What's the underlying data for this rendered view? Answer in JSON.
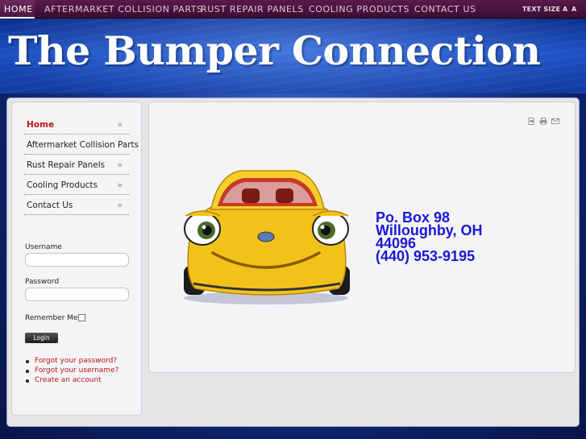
{
  "topnav": {
    "items": [
      "HOME",
      "AFTERMARKET COLLISION PARTS",
      "RUST REPAIR PANELS",
      "COOLING PRODUCTS",
      "CONTACT US"
    ],
    "active": "HOME",
    "textsize_label": "TEXT SIZE",
    "textsize_small": "A",
    "textsize_large": "A"
  },
  "header": {
    "site_title": "The Bumper Connection"
  },
  "sidebar": {
    "menu": [
      {
        "label": "Home",
        "has_chevron": true,
        "active": true
      },
      {
        "label": "Aftermarket Collision Parts",
        "has_chevron": false,
        "active": false
      },
      {
        "label": "Rust Repair Panels",
        "has_chevron": true,
        "active": false
      },
      {
        "label": "Cooling Products",
        "has_chevron": true,
        "active": false
      },
      {
        "label": "Contact Us",
        "has_chevron": true,
        "active": false
      }
    ],
    "chevron": "»"
  },
  "login": {
    "username_label": "Username",
    "username_value": "",
    "password_label": "Password",
    "password_value": "",
    "remember_label": "Remember Me",
    "remember_checked": false,
    "button_label": "Login",
    "links": [
      "Forgot your password?",
      "Forgot your username?",
      "Create an account"
    ]
  },
  "content": {
    "tools": [
      "pdf-icon",
      "print-icon",
      "email-icon"
    ],
    "address_lines": [
      "Po. Box 98",
      "Willoughby, OH",
      "44096",
      "(440) 953-9195"
    ]
  },
  "colors": {
    "nav_bg": "#3a0d34",
    "accent_red": "#c0141b",
    "address_blue": "#1a18d8",
    "header_blue": "#1b4fc4"
  }
}
